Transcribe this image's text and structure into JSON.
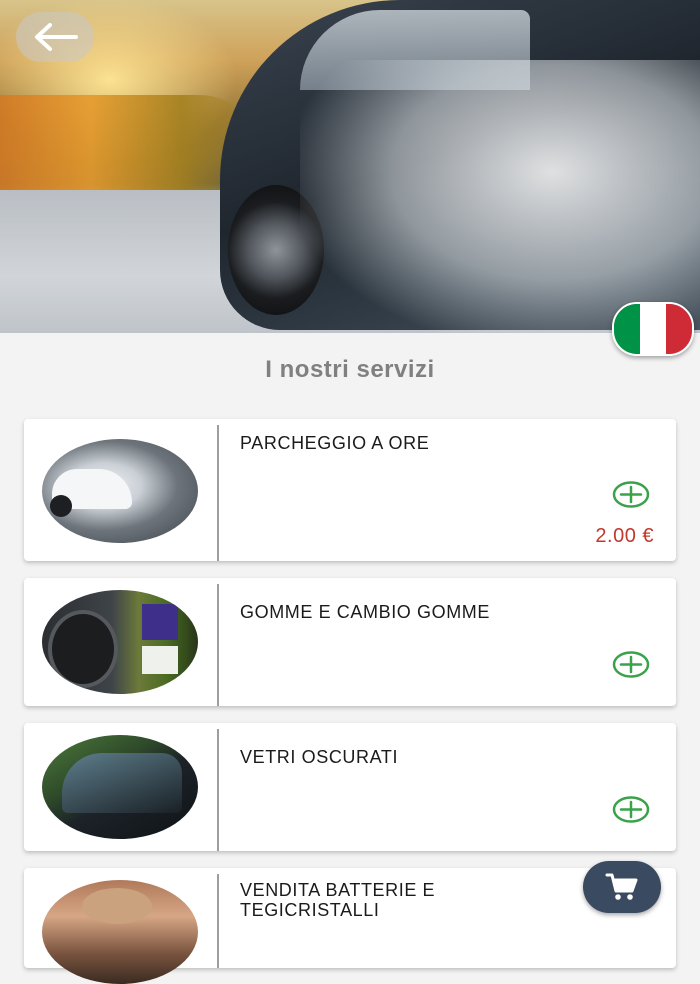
{
  "header": {
    "back_icon": "arrow-left-icon",
    "language_flag": "italian-flag-icon",
    "flag_colors": [
      "#009246",
      "#ffffff",
      "#ce2b37"
    ]
  },
  "section_title": "I nostri servizi",
  "services": [
    {
      "name": "PARCHEGGIO A ORE",
      "price": "2.00 €",
      "add_icon": "plus-circle-icon"
    },
    {
      "name": "GOMME E CAMBIO GOMME",
      "add_icon": "plus-circle-icon"
    },
    {
      "name": "VETRI OSCURATI",
      "add_icon": "plus-circle-icon"
    },
    {
      "name": "VENDITA BATTERIE E TEGICRISTALLI"
    }
  ],
  "cart": {
    "icon": "cart-icon"
  },
  "colors": {
    "accent_green": "#3aa24a",
    "price_red": "#c0392b",
    "cart_button": "#3a4a60"
  }
}
